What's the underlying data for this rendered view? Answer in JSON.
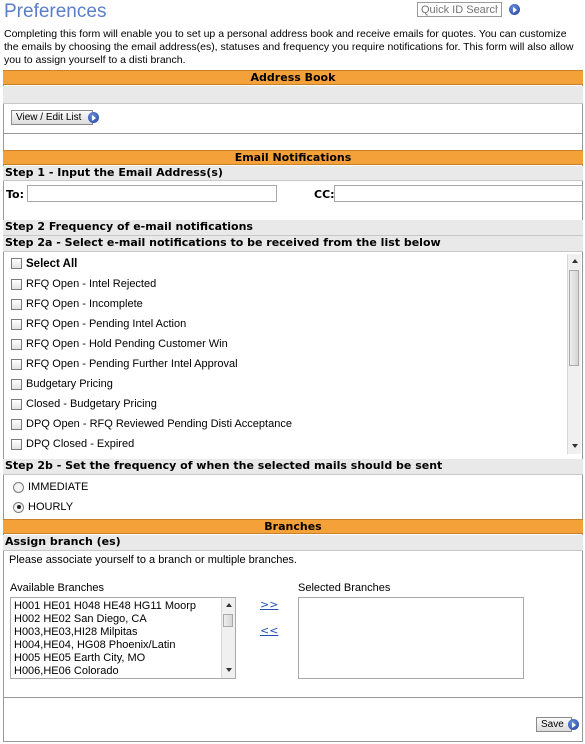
{
  "header": {
    "title": "Preferences",
    "quick_id_placeholder": "Quick ID Search",
    "go_icon": "go-arrow-icon"
  },
  "intro_text": "Completing this form will enable you to set up a personal address book and receive emails for quotes. You can customize the emails by choosing the email address(es), statuses and frequency you require notifications for. This form will also allow you to assign yourself to a disti branch.",
  "address_book": {
    "section_title": "Address Book",
    "view_edit_label": "View / Edit List"
  },
  "email_notifications": {
    "section_title": "Email Notifications",
    "step1_title": "Step 1 - Input the Email Address(s)",
    "to_label": "To:",
    "to_value": "",
    "cc_label": "CC:",
    "cc_value": "",
    "step2_title": "Step 2 Frequency of e-mail notifications",
    "step2a_title": "Step 2a - Select e-mail notifications to be received from the list below",
    "select_all_label": "Select All",
    "items": [
      {
        "label": "RFQ Open - Intel Rejected",
        "checked": false
      },
      {
        "label": "RFQ Open - Incomplete",
        "checked": false
      },
      {
        "label": "RFQ Open - Pending Intel Action",
        "checked": false
      },
      {
        "label": "RFQ Open - Hold Pending Customer Win",
        "checked": false
      },
      {
        "label": "RFQ Open - Pending Further Intel Approval",
        "checked": false
      },
      {
        "label": "Budgetary Pricing",
        "checked": false
      },
      {
        "label": "Closed - Budgetary Pricing",
        "checked": false
      },
      {
        "label": "DPQ Open - RFQ Reviewed Pending Disti Acceptance",
        "checked": false
      },
      {
        "label": "DPQ Closed - Expired",
        "checked": false
      }
    ],
    "step2b_title": "Step 2b - Set the frequency of when the selected mails should be sent",
    "frequency_options": [
      {
        "label": "IMMEDIATE",
        "selected": false
      },
      {
        "label": "HOURLY",
        "selected": true
      }
    ]
  },
  "branches": {
    "section_title": "Branches",
    "assign_title": "Assign branch (es)",
    "instruction": "Please associate yourself to a branch or multiple branches.",
    "available_label": "Available Branches",
    "selected_label": "Selected Branches",
    "available": [
      "H001 HE01 H048 HE48 HG11 Moorp",
      "H002 HE02 San Diego, CA",
      "H003,HE03,HI28 Milpitas",
      "H004,HE04, HG08 Phoenix/Latin",
      "H005 HE05 Earth City, MO",
      "H006,HE06 Colorado"
    ],
    "selected": [],
    "add_label": ">>",
    "remove_label": "<<"
  },
  "footer": {
    "save_label": "Save"
  }
}
